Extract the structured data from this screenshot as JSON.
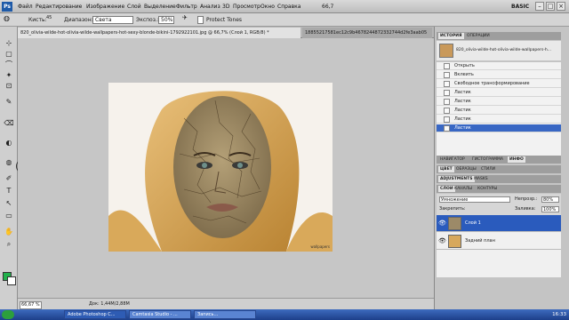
{
  "app": {
    "logo_text": "Ps",
    "menu": [
      "Файл",
      "Редактирование",
      "Изображение",
      "Слой",
      "Выделение",
      "Фильтр",
      "Анализ",
      "3D",
      "Просмотр",
      "Окно",
      "Справка"
    ],
    "zoom": "66,7",
    "workspace": "BASIC",
    "window_buttons": [
      "–",
      "□",
      "×"
    ]
  },
  "options": {
    "brush_label": "Кисть:",
    "brush_size": "45",
    "mode_label": "Диапазон:",
    "mode_value": "Света",
    "exposure_label": "Экспоз.:",
    "exposure_value": "50%",
    "protect_label": "Protect Tones"
  },
  "tools": [
    "⊹",
    "▢",
    "⌒",
    "✦",
    "⊡",
    "✎",
    "⌫",
    "◐",
    "◍",
    "✐",
    "T",
    "↖",
    "▭",
    "✋",
    "⌕"
  ],
  "colors": {
    "foreground": "#22b14c",
    "background": "#ffffff",
    "selection": "#3867c4"
  },
  "documents": {
    "tabs": [
      "820_olivia-wilde-hot-olivia-wilde-wallpapers-hot-sexy-blonde-bikini-1792922101.jpg @ 66,7% (Слой 1, RGB/8) *",
      "18855217581ec12c9b4678244872332744d2fe3aab05"
    ]
  },
  "image": {
    "credit": "wallpapers"
  },
  "status": {
    "zoom": "66,67 %",
    "doc_size": "Док: 1,44M/2,88M"
  },
  "panels": {
    "history_tabs": [
      "ИСТОРИЯ",
      "ОПЕРАЦИИ"
    ],
    "history_snapshot": "820_olivia-wilde-hot-olivia-wilde-wallpapers-h...",
    "history_items": [
      "Открыть",
      "Вклеить",
      "Свободное трансформирование",
      "Ластик",
      "Ластик",
      "Ластик",
      "Ластик",
      "Ластик"
    ],
    "nav_tabs": [
      "НАВИГАТОР",
      "ГИСТОГРАММА",
      "ИНФО"
    ],
    "color_tabs": [
      "ЦВЕТ",
      "ОБРАЗЦЫ",
      "СТИЛИ"
    ],
    "adj_tabs": [
      "ADJUSTMENTS",
      "MASKS"
    ],
    "layer_tabs": [
      "СЛОИ",
      "КАНАЛЫ",
      "КОНТУРЫ"
    ],
    "blend_mode": "Умножение",
    "opacity_label": "Непрозр.:",
    "opacity_value": "80%",
    "lock_label": "Закрепить:",
    "fill_label": "Заливка:",
    "fill_value": "100%",
    "layers": [
      "Слой 1",
      "Задний план"
    ]
  },
  "taskbar": {
    "apps": [
      "Adobe Photoshop C...",
      "Camtasia Studio - ...",
      "Запись..."
    ],
    "clock": "16:33"
  }
}
